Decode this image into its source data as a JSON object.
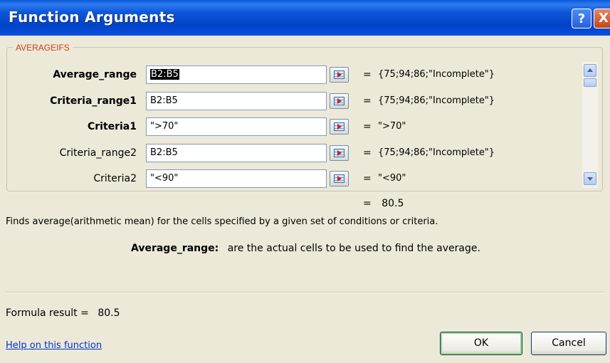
{
  "window": {
    "title": "Function Arguments",
    "help_button": "?",
    "close_button": "X"
  },
  "function_name": "AVERAGEIFS",
  "args": [
    {
      "label": "Average_range",
      "value": "B2:B5",
      "result": "{75;94;86;\"Incomplete\"}",
      "bold": true,
      "selected": true
    },
    {
      "label": "Criteria_range1",
      "value": "B2:B5",
      "result": "{75;94;86;\"Incomplete\"}",
      "bold": true
    },
    {
      "label": "Criteria1",
      "value": "\">70\"",
      "result": "\">70\"",
      "bold": true
    },
    {
      "label": "Criteria_range2",
      "value": "B2:B5",
      "result": "{75;94;86;\"Incomplete\"}",
      "bold": false
    },
    {
      "label": "Criteria2",
      "value": "\"<90\"",
      "result": "\"<90\"",
      "bold": false
    }
  ],
  "equals_sign": "=",
  "function_result": "80.5",
  "description": "Finds average(arithmetic mean) for the cells specified by a given set of conditions or criteria.",
  "arg_help": {
    "name": "Average_range:",
    "text": "are the actual cells to be used to find the average."
  },
  "formula_result": {
    "label": "Formula result =",
    "value": "80.5"
  },
  "help_link": "Help on this function",
  "buttons": {
    "ok": "OK",
    "cancel": "Cancel"
  },
  "colors": {
    "titlebar": "#0a4ee0",
    "group_label": "#cc3d1e",
    "link": "#0033cc",
    "dialog_bg": "#ece9d8"
  }
}
